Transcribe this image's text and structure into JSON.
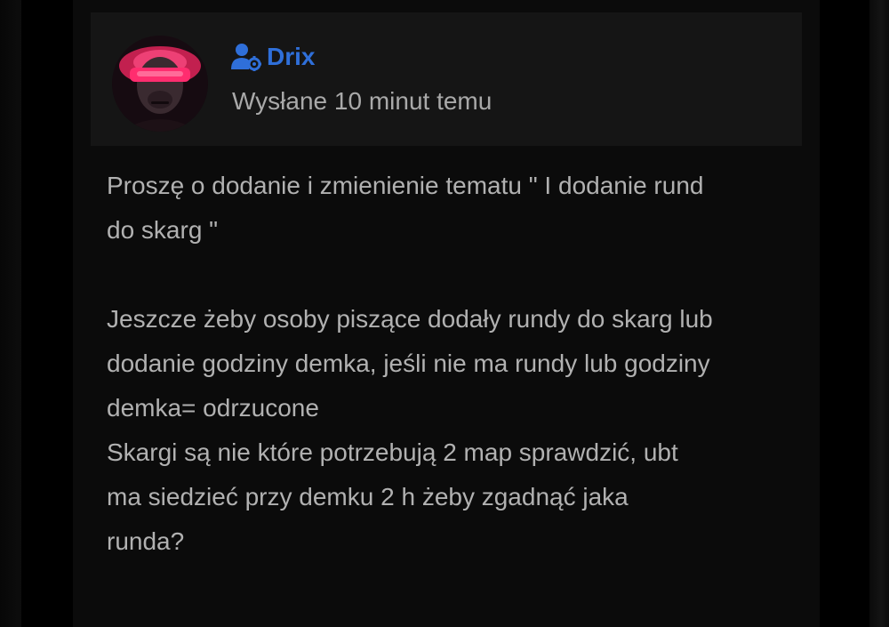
{
  "post": {
    "author": "Drix",
    "time": "Wysłane 10 minut temu",
    "body_lines": [
      "Proszę o dodanie i zmienienie tematu  \" I dodanie rund",
      "do skarg \"",
      "",
      "Jeszcze żeby osoby piszące dodały rundy do skarg lub",
      "dodanie godziny demka, jeśli nie ma rundy lub godziny",
      "demka= odrzucone",
      "Skargi są nie które potrzebują 2 map sprawdzić, ubt",
      "ma siedzieć przy demku 2 h żeby zgadnąć jaka",
      "runda?"
    ]
  },
  "icons": {
    "author_role": "user-gear-icon",
    "avatar": "avatar-image"
  },
  "colors": {
    "accent": "#2f6fd9",
    "background": "#0b0b0b",
    "header_bg": "#151515",
    "text": "#b1b1b1",
    "muted": "#a9a9a9"
  }
}
